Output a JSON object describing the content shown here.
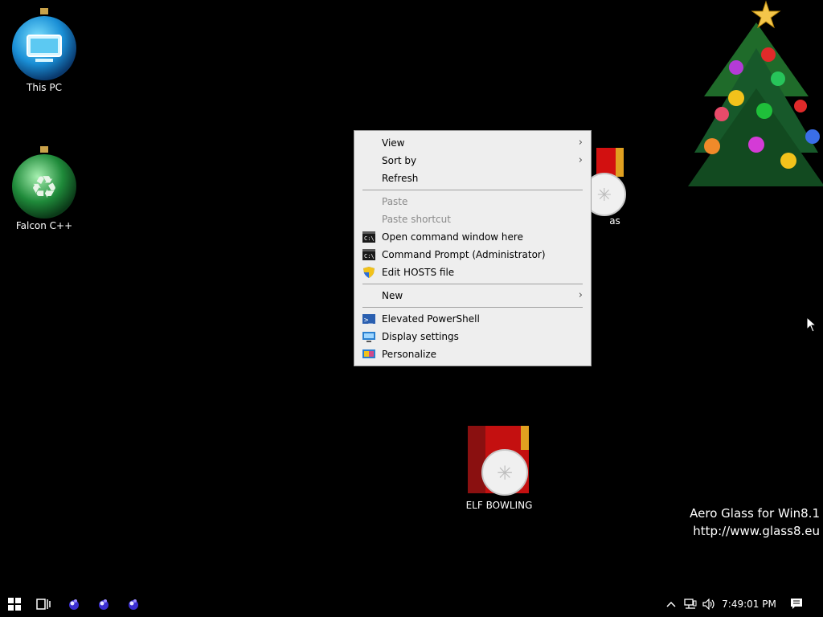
{
  "desktop": {
    "icons": [
      {
        "label": "This PC"
      },
      {
        "label": "Falcon C++"
      },
      {
        "label": "as"
      },
      {
        "label": "ELF BOWLING"
      }
    ]
  },
  "context_menu": {
    "items": [
      {
        "label": "View",
        "submenu": true
      },
      {
        "label": "Sort by",
        "submenu": true
      },
      {
        "label": "Refresh"
      },
      {
        "label": "Paste",
        "disabled": true
      },
      {
        "label": "Paste shortcut",
        "disabled": true
      },
      {
        "label": "Open command window here",
        "icon": "cmd-icon"
      },
      {
        "label": "Command Prompt (Administrator)",
        "icon": "cmd-icon"
      },
      {
        "label": "Edit HOSTS file",
        "icon": "shield-icon"
      },
      {
        "label": "New",
        "submenu": true
      },
      {
        "label": "Elevated PowerShell",
        "icon": "powershell-icon"
      },
      {
        "label": "Display settings",
        "icon": "display-icon"
      },
      {
        "label": "Personalize",
        "icon": "personalize-icon"
      }
    ]
  },
  "watermark": {
    "line1": "Aero Glass for Win8.1",
    "line2": "http://www.glass8.eu"
  },
  "taskbar": {
    "clock": "7:49:01 PM",
    "pinned_icons": [
      "start-icon",
      "task-view-icon",
      "app-icon",
      "app-icon",
      "app-icon"
    ],
    "tray_icons": [
      "chevron-up-icon",
      "network-icon",
      "volume-icon",
      "notifications-icon"
    ]
  },
  "colors": {
    "desktop_bg": "#000000",
    "menu_bg": "#eeeeee",
    "menu_disabled": "#8a8a8a"
  }
}
